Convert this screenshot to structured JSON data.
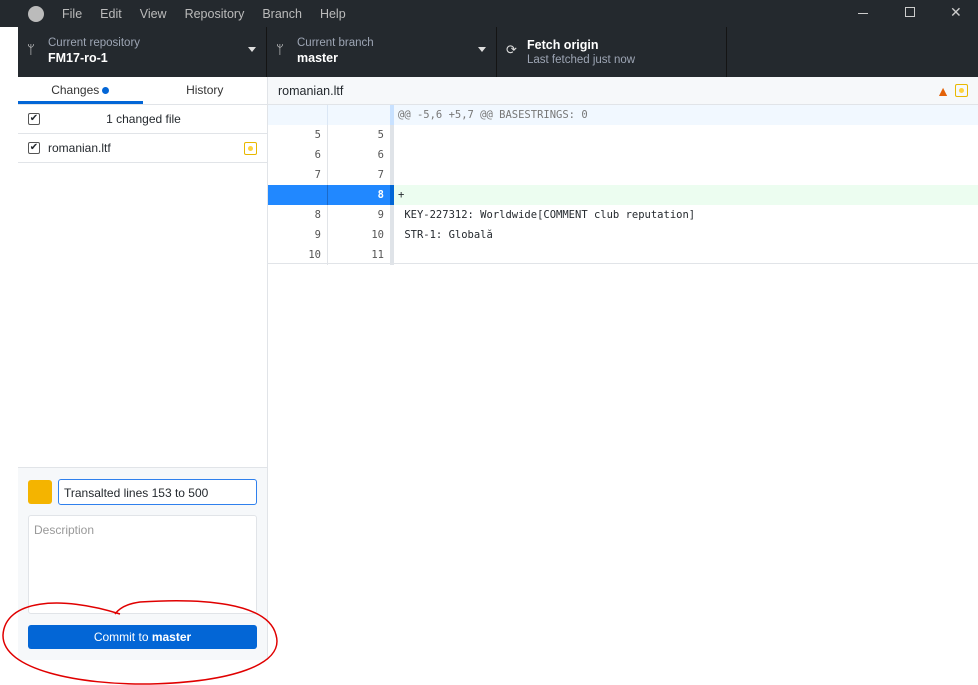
{
  "menu": [
    "File",
    "Edit",
    "View",
    "Repository",
    "Branch",
    "Help"
  ],
  "toolbar": {
    "repo_label": "Current repository",
    "repo_name": "FM17-ro-1",
    "branch_label": "Current branch",
    "branch_name": "master",
    "fetch_title": "Fetch origin",
    "fetch_sub": "Last fetched just now"
  },
  "tabs": {
    "changes": "Changes",
    "history": "History"
  },
  "changes": {
    "summary": "1 changed file",
    "files": [
      {
        "name": "romanian.ltf",
        "status": "modified"
      }
    ]
  },
  "diff": {
    "file": "romanian.ltf",
    "hunk": "@@ -5,6 +5,7 @@ BASESTRINGS: 0",
    "lines": [
      {
        "old": "5",
        "new": "5",
        "text": "",
        "type": "context"
      },
      {
        "old": "6",
        "new": "6",
        "text": "",
        "type": "context"
      },
      {
        "old": "7",
        "new": "7",
        "text": "",
        "type": "context"
      },
      {
        "old": "",
        "new": "8",
        "text": "+",
        "type": "added"
      },
      {
        "old": "8",
        "new": "9",
        "text": " KEY-227312: Worldwide[COMMENT club reputation]",
        "type": "context"
      },
      {
        "old": "9",
        "new": "10",
        "text": " STR-1: Globală",
        "type": "context"
      },
      {
        "old": "10",
        "new": "11",
        "text": "",
        "type": "context"
      }
    ]
  },
  "commit": {
    "summary_value": "Transalted lines 153 to 500",
    "description_placeholder": "Description",
    "button_prefix": "Commit to ",
    "button_branch": "master"
  },
  "colors": {
    "accent": "#0366d6",
    "titlebar": "#24292e",
    "added_bg": "#ecfdf0",
    "annotation": "#e00000"
  }
}
